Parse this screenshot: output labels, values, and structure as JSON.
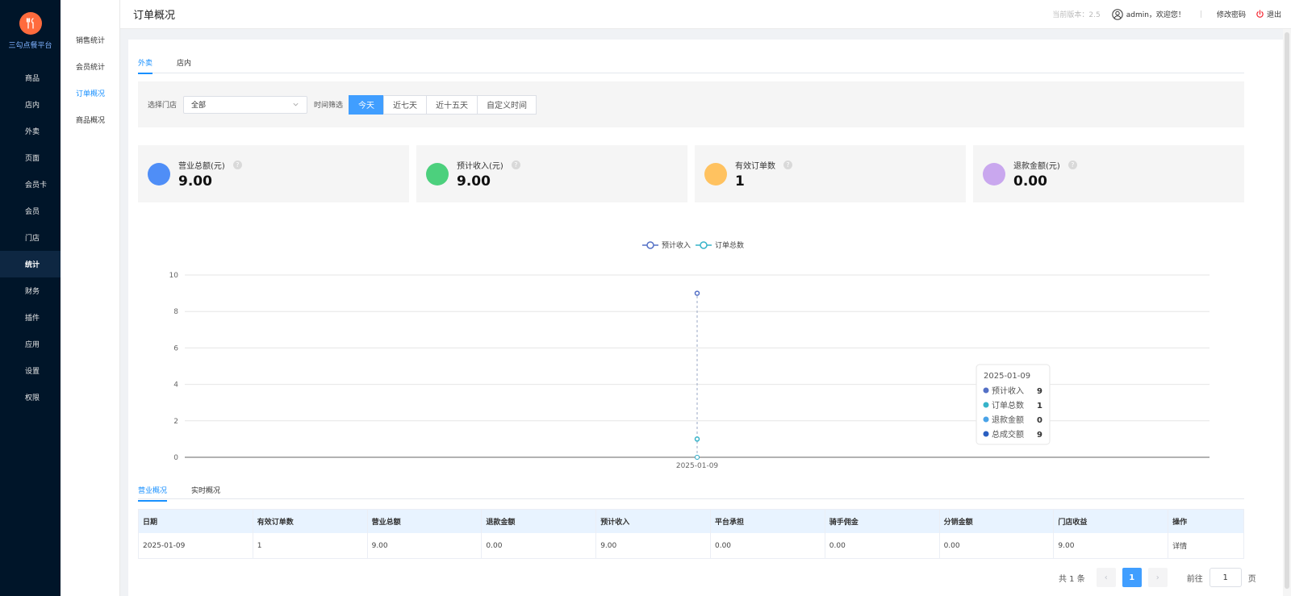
{
  "brand": {
    "name": "三勾点餐平台"
  },
  "nav": [
    {
      "label": "商品",
      "icon": "box-icon"
    },
    {
      "label": "店内",
      "icon": "utensils-icon"
    },
    {
      "label": "外卖",
      "icon": "delivery-icon"
    },
    {
      "label": "页面",
      "icon": "page-icon"
    },
    {
      "label": "会员卡",
      "icon": "card-icon"
    },
    {
      "label": "会员",
      "icon": "crown-icon"
    },
    {
      "label": "门店",
      "icon": "store-icon"
    },
    {
      "label": "统计",
      "icon": "chart-icon",
      "active": true
    },
    {
      "label": "财务",
      "icon": "finance-icon"
    },
    {
      "label": "插件",
      "icon": "plugin-icon"
    },
    {
      "label": "应用",
      "icon": "apps-icon"
    },
    {
      "label": "设置",
      "icon": "gear-icon"
    },
    {
      "label": "权限",
      "icon": "shield-icon"
    }
  ],
  "subnav": [
    {
      "label": "销售统计"
    },
    {
      "label": "会员统计"
    },
    {
      "label": "订单概况",
      "active": true
    },
    {
      "label": "商品概况"
    }
  ],
  "header": {
    "title": "订单概况",
    "version": "当前版本：2.5",
    "welcome": "admin，欢迎您！",
    "separator": "|",
    "change_password": "修改密码",
    "logout": "退出"
  },
  "tabs": [
    {
      "label": "外卖",
      "active": true
    },
    {
      "label": "店内"
    }
  ],
  "filter": {
    "store_label": "选择门店",
    "store_value": "全部",
    "time_label": "时间筛选",
    "time_options": [
      {
        "label": "今天",
        "active": true
      },
      {
        "label": "近七天"
      },
      {
        "label": "近十五天"
      },
      {
        "label": "自定义时间"
      }
    ]
  },
  "stats": [
    {
      "label": "营业总额(元)",
      "value": "9.00",
      "color": "#4f8ef7",
      "icon": "trend-icon"
    },
    {
      "label": "预计收入(元)",
      "value": "9.00",
      "color": "#4cd07d",
      "icon": "income-icon"
    },
    {
      "label": "有效订单数",
      "value": "1",
      "color": "#ffc260",
      "icon": "clipboard-icon"
    },
    {
      "label": "退款金额(元)",
      "value": "0.00",
      "color": "#c9a7ee",
      "icon": "refund-icon"
    }
  ],
  "chart_data": {
    "type": "line",
    "categories": [
      "2025-01-09"
    ],
    "series": [
      {
        "name": "预计收入",
        "values": [
          9
        ],
        "color": "#5470c6"
      },
      {
        "name": "订单总数",
        "values": [
          1
        ],
        "color": "#36b3c9"
      }
    ],
    "ylim": [
      0,
      10
    ],
    "yticks": [
      0,
      2,
      4,
      6,
      8,
      10
    ],
    "legend": "top-center",
    "tooltip": {
      "title": "2025-01-09",
      "rows": [
        {
          "label": "预计收入",
          "value": "9",
          "color": "#5470c6"
        },
        {
          "label": "订单总数",
          "value": "1",
          "color": "#36b3c9"
        },
        {
          "label": "退款金额",
          "value": "0",
          "color": "#4aa3e8"
        },
        {
          "label": "总成交额",
          "value": "9",
          "color": "#2a5fc1"
        }
      ]
    }
  },
  "bottom_tabs": [
    {
      "label": "营业概况",
      "active": true
    },
    {
      "label": "实时概况"
    }
  ],
  "table": {
    "columns": [
      "日期",
      "有效订单数",
      "营业总额",
      "退款金额",
      "预计收入",
      "平台承担",
      "骑手佣金",
      "分销金额",
      "门店收益",
      "操作"
    ],
    "rows": [
      [
        "2025-01-09",
        "1",
        "9.00",
        "0.00",
        "9.00",
        "0.00",
        "0.00",
        "0.00",
        "9.00",
        "详情"
      ]
    ]
  },
  "pagination": {
    "total": "共 1 条",
    "current": "1",
    "goto_label": "前往",
    "goto_value": "1",
    "page_unit": "页"
  }
}
